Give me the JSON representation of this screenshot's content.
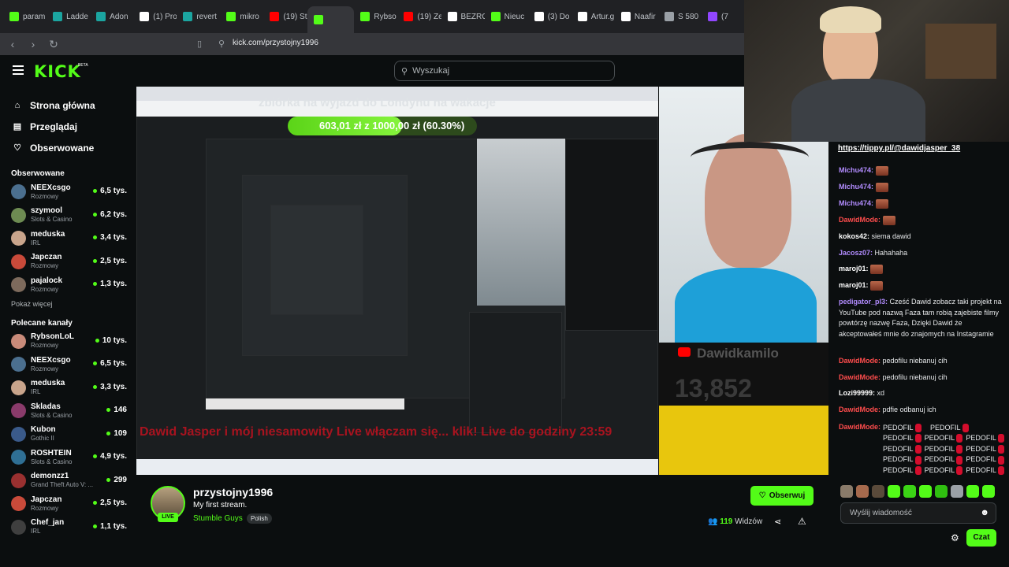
{
  "browser": {
    "tabs": [
      {
        "label": "param",
        "color": "#53fc18"
      },
      {
        "label": "Ladde",
        "color": "#1ba5a0"
      },
      {
        "label": "Adon",
        "color": "#1ba5a0"
      },
      {
        "label": "(1) Pro",
        "color": "#ffffff"
      },
      {
        "label": "revert",
        "color": "#1ba5a0"
      },
      {
        "label": "mikro",
        "color": "#53fc18"
      },
      {
        "label": "(19) St",
        "color": "#ff0000"
      },
      {
        "label": "",
        "color": "#53fc18"
      },
      {
        "label": "Rybso",
        "color": "#53fc18"
      },
      {
        "label": "(19) Ze",
        "color": "#ff0000"
      },
      {
        "label": "BEZRO",
        "color": "#ffffff"
      },
      {
        "label": "Nieuc",
        "color": "#53fc18"
      },
      {
        "label": "(3) Do",
        "color": "#ffffff"
      },
      {
        "label": "Artur.g",
        "color": "#ffffff"
      },
      {
        "label": "Naafir",
        "color": "#ffffff"
      },
      {
        "label": "S 580",
        "color": "#9aa0a6"
      },
      {
        "label": "(7",
        "color": "#9146ff"
      }
    ],
    "url": "kick.com/przystojny1996"
  },
  "header": {
    "logo": "KICK",
    "logo_badge": "BETA",
    "search_placeholder": "Wyszukaj"
  },
  "sidebar": {
    "nav": [
      {
        "label": "Strona główna",
        "icon": "home-icon"
      },
      {
        "label": "Przeglądaj",
        "icon": "browse-icon"
      },
      {
        "label": "Obserwowane",
        "icon": "heart-icon"
      }
    ],
    "followed_title": "Obserwowane",
    "followed": [
      {
        "name": "NEEXcsgo",
        "category": "Rozmowy",
        "viewers": "6,5 tys.",
        "color": "#4b6f8f"
      },
      {
        "name": "szymool",
        "category": "Slots & Casino",
        "viewers": "6,2 tys.",
        "color": "#6d8b52"
      },
      {
        "name": "meduska",
        "category": "IRL",
        "viewers": "3,4 tys.",
        "color": "#c9a58c"
      },
      {
        "name": "Japczan",
        "category": "Rozmowy",
        "viewers": "2,5 tys.",
        "color": "#c94a3a"
      },
      {
        "name": "pajalock",
        "category": "Rozmowy",
        "viewers": "1,3 tys.",
        "color": "#7d6a5c"
      }
    ],
    "show_more": "Pokaż więcej",
    "recommended_title": "Polecane kanały",
    "recommended": [
      {
        "name": "RybsonLoL",
        "category": "Rozmowy",
        "viewers": "10 tys.",
        "color": "#c98b7a"
      },
      {
        "name": "NEEXcsgo",
        "category": "Rozmowy",
        "viewers": "6,5 tys.",
        "color": "#4b6f8f"
      },
      {
        "name": "meduska",
        "category": "IRL",
        "viewers": "3,3 tys.",
        "color": "#c9a58c"
      },
      {
        "name": "Skladas",
        "category": "Slots & Casino",
        "viewers": "146",
        "color": "#8a3b6b"
      },
      {
        "name": "Kubon",
        "category": "Gothic II",
        "viewers": "109",
        "color": "#3a5a8a"
      },
      {
        "name": "ROSHTEIN",
        "category": "Slots & Casino",
        "viewers": "4,9 tys.",
        "color": "#2f6f94"
      },
      {
        "name": "demonzz1",
        "category": "Grand Theft Auto V: ...",
        "viewers": "299",
        "color": "#9a3030"
      },
      {
        "name": "Japczan",
        "category": "Rozmowy",
        "viewers": "2,5 tys.",
        "color": "#c94a3a"
      },
      {
        "name": "Chef_jan",
        "category": "IRL",
        "viewers": "1,1 tys.",
        "color": "#3f3f3f"
      }
    ]
  },
  "video": {
    "goal_title": "zbiórka na wyjazd do Londynu na wakacje",
    "goal_text": "603,01 zł z 1000,00 zł (60.30%)",
    "goal_progress": 0.603,
    "ticker": "Dawid Jasper i mój niesamowity Live włączam się... klik! Live do godziny 23:59",
    "yt_number": "13,852",
    "yt_channel": "Dawidkamilo"
  },
  "chat": {
    "link": "https://tippy.pl/@dawidjasper_38",
    "messages": [
      {
        "user": "Michu474:",
        "color": "#b28cff",
        "text": "",
        "emote": true
      },
      {
        "user": "Michu474:",
        "color": "#b28cff",
        "text": "",
        "emote": true
      },
      {
        "user": "Michu474:",
        "color": "#b28cff",
        "text": "",
        "emote": true
      },
      {
        "user": "DawidMode:",
        "color": "#ff4d4d",
        "text": "",
        "emote": true
      },
      {
        "user": "kokos42:",
        "color": "#ffffff",
        "text": "siema dawid",
        "emote": false
      },
      {
        "user": "Jacosz07:",
        "color": "#b28cff",
        "text": "Hahahaha",
        "emote": false
      },
      {
        "user": "maroj01:",
        "color": "#ffffff",
        "text": "",
        "emote": true
      },
      {
        "user": "maroj01:",
        "color": "#ffffff",
        "text": "",
        "emote": true
      },
      {
        "user": "pedigator_pl3:",
        "color": "#b28cff",
        "text": "Cześć Dawid zobacz taki projekt na YouTube pod nazwą Faza tam robią zajebiste filmy powtórzę nazwę Faza, Dzięki Dawid że akceptowałeś mnie do znajomych na Instagramie",
        "emote": false
      },
      {
        "user": "DawidMode:",
        "color": "#ff4d4d",
        "text": "pedofilu niebanuj cih",
        "emote": false
      },
      {
        "user": "DawidMode:",
        "color": "#ff4d4d",
        "text": "pedofilu niebanuj cih",
        "emote": false
      },
      {
        "user": "Lozi99999:",
        "color": "#ffffff",
        "text": "xd",
        "emote": false
      },
      {
        "user": "DawidMode:",
        "color": "#ff4d4d",
        "text": "pdfie odbanuj ich",
        "emote": false
      }
    ],
    "spam_user": "DawidMode:",
    "spam_word": "PEDOFIL",
    "input_placeholder": "Wyślij wiadomość",
    "send_label": "Czat"
  },
  "stream": {
    "name": "przystojny1996",
    "title": "My first stream.",
    "category": "Stumble Guys",
    "language": "Polish",
    "live": "LIVE",
    "follow_label": "Obserwuj",
    "viewers_count": "119",
    "viewers_label": "Widzów"
  }
}
